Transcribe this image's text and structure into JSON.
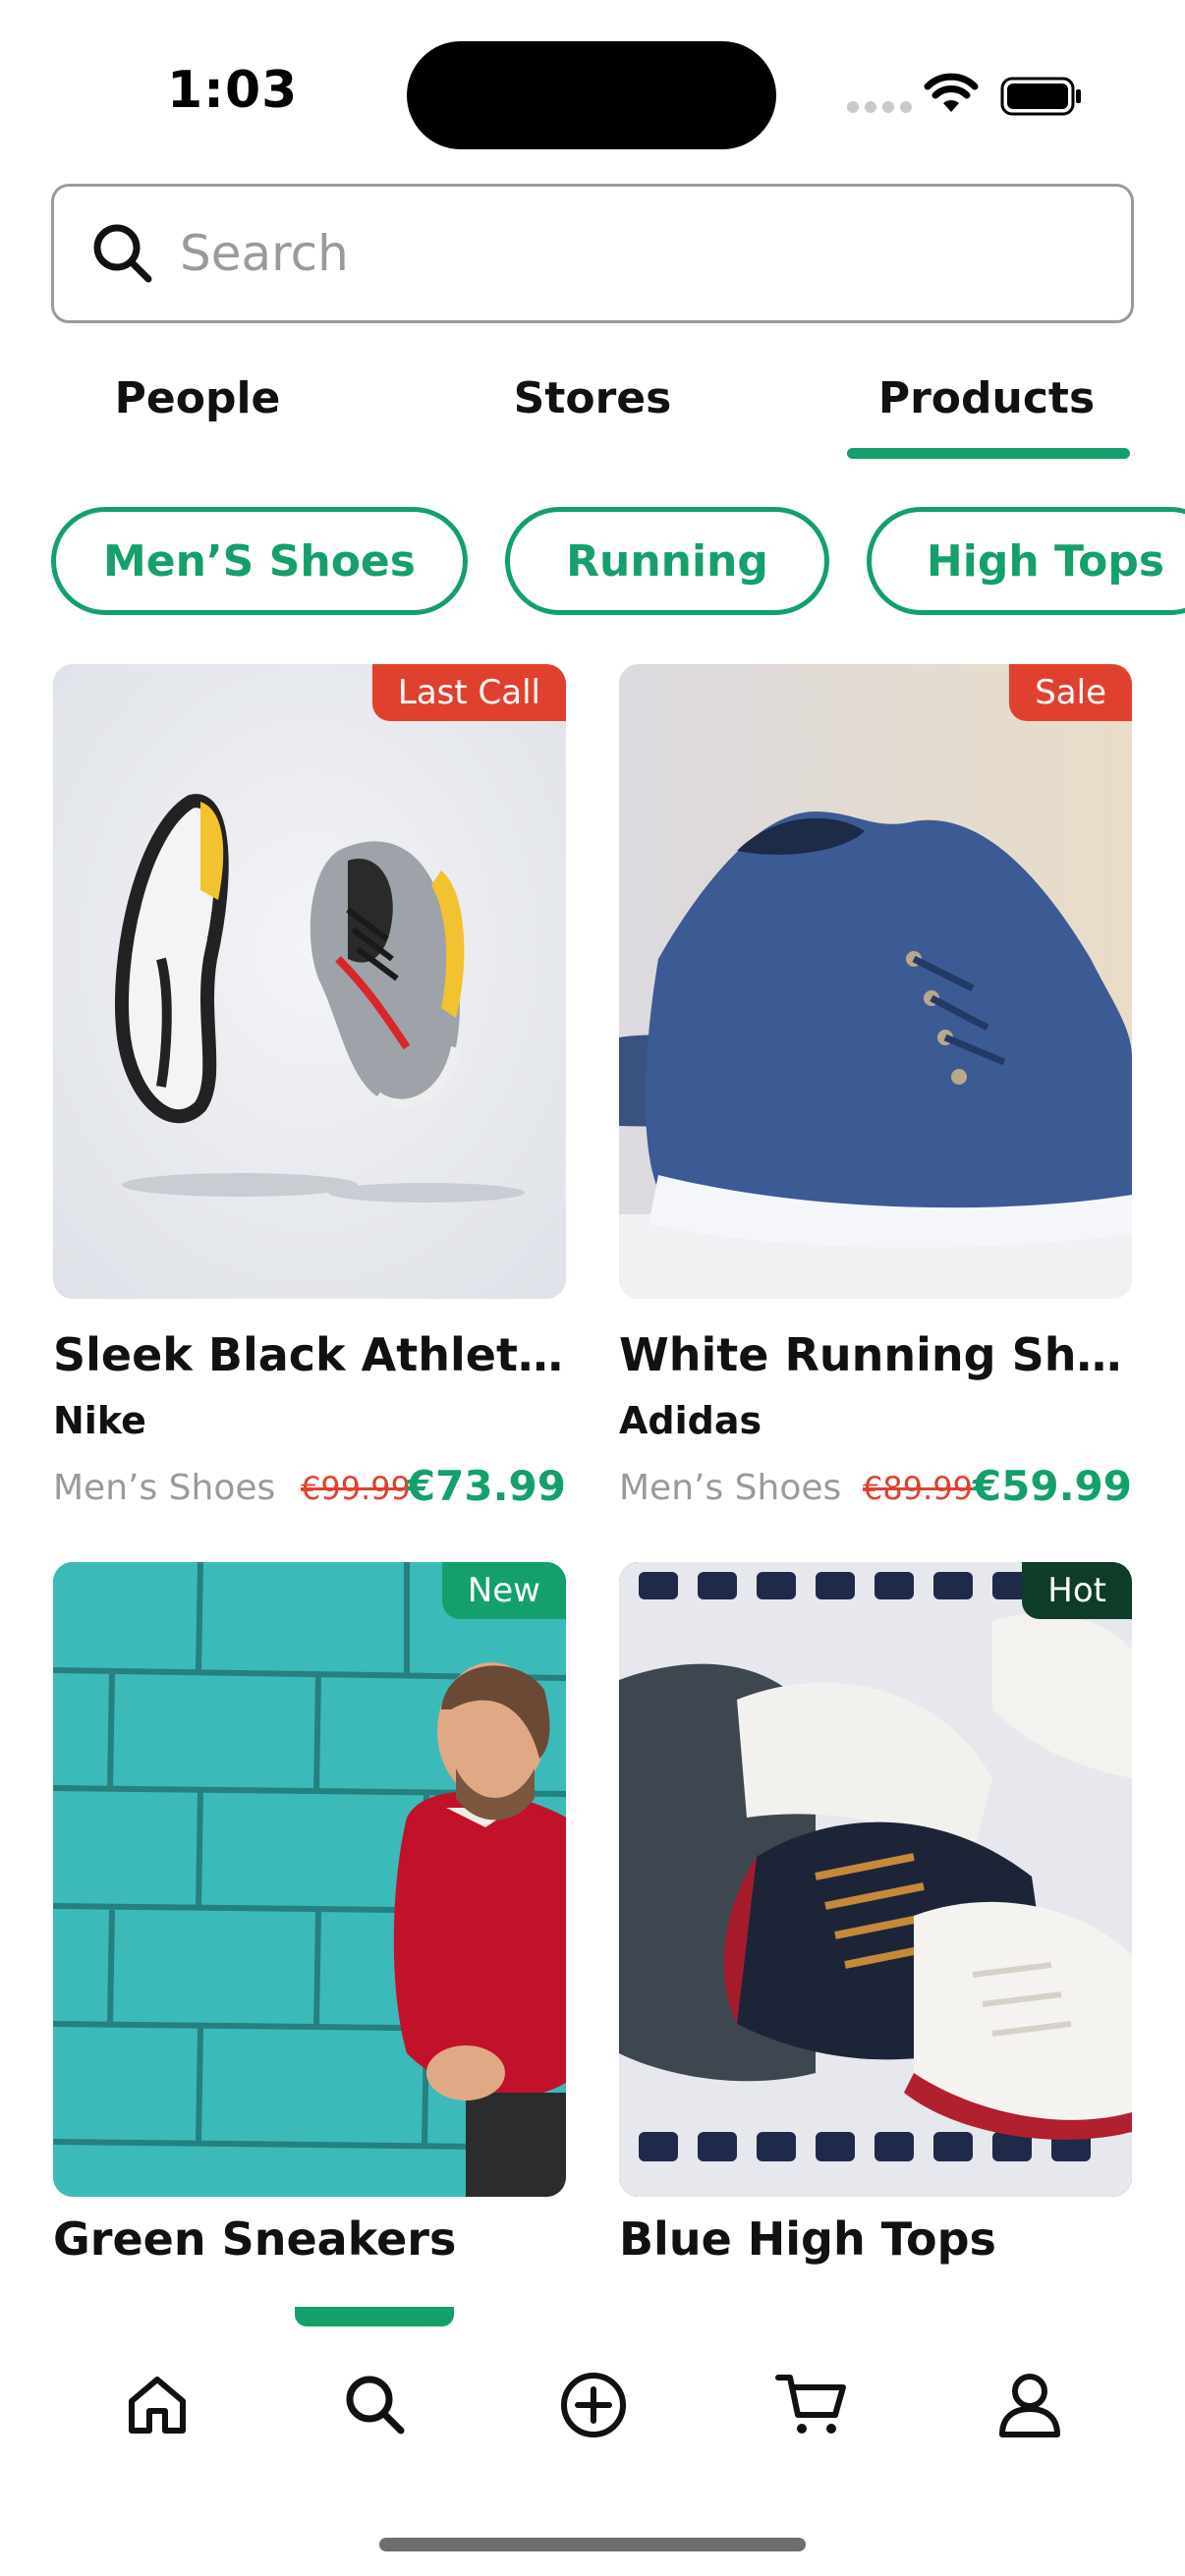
{
  "status_bar": {
    "time": "1:03"
  },
  "search": {
    "placeholder": "Search"
  },
  "tabs": [
    {
      "label": "People",
      "active": false
    },
    {
      "label": "Stores",
      "active": false
    },
    {
      "label": "Products",
      "active": true
    }
  ],
  "chips": [
    {
      "label": "Men’S Shoes"
    },
    {
      "label": "Running"
    },
    {
      "label": "High Tops"
    }
  ],
  "products": [
    {
      "title": "Sleek Black Athletic S…",
      "brand": "Nike",
      "category": "Men’s Shoes",
      "old_price": "€99.99",
      "price": "€73.99",
      "badge": "Last Call",
      "badge_color": "#e0412e"
    },
    {
      "title": "White Running Shoes",
      "brand": "Adidas",
      "category": "Men’s Shoes",
      "old_price": "€89.99",
      "price": "€59.99",
      "badge": "Sale",
      "badge_color": "#e0412e"
    },
    {
      "title": "Green Sneakers",
      "brand": "",
      "category": "",
      "old_price": "",
      "price": "",
      "badge": "New",
      "badge_color": "#14a06a"
    },
    {
      "title": "Blue High Tops",
      "brand": "",
      "category": "",
      "old_price": "",
      "price": "",
      "badge": "Hot",
      "badge_color": "#0d3d26"
    }
  ],
  "bottom_nav": [
    {
      "icon": "home-icon",
      "active": false
    },
    {
      "icon": "search-icon",
      "active": true
    },
    {
      "icon": "add-circle-icon",
      "active": false
    },
    {
      "icon": "cart-icon",
      "active": false
    },
    {
      "icon": "profile-icon",
      "active": false
    }
  ],
  "colors": {
    "accent": "#14a06a",
    "sale_red": "#e0412e",
    "hot_dark_green": "#0d3d26"
  }
}
